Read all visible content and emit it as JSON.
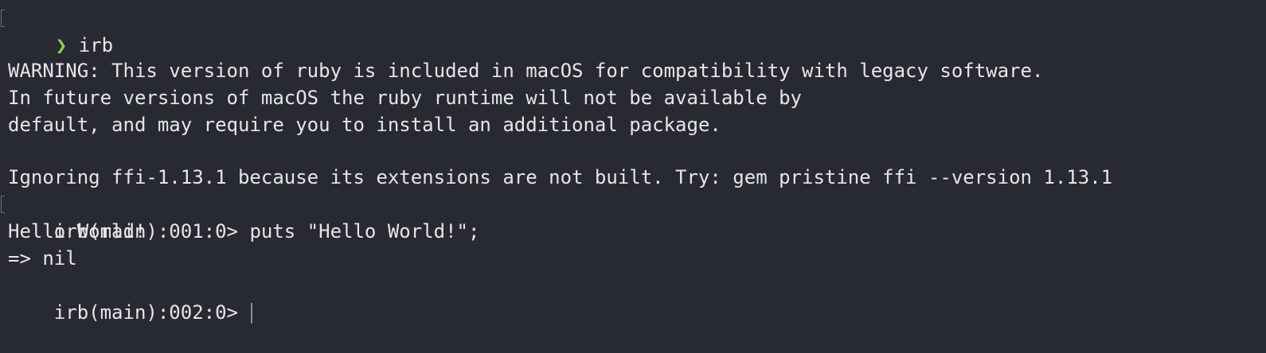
{
  "shell": {
    "prompt_symbol": "❯",
    "command": "irb"
  },
  "output": {
    "warning_line1": "WARNING: This version of ruby is included in macOS for compatibility with legacy software.",
    "warning_line2": "In future versions of macOS the ruby runtime will not be available by",
    "warning_line3": "default, and may require you to install an additional package.",
    "ignoring_line": "Ignoring ffi-1.13.1 because its extensions are not built. Try: gem pristine ffi --version 1.13.1",
    "irb_prompt_1": "irb(main):001:0> ",
    "irb_input_1": "puts \"Hello World!\";",
    "result_output": "Hello World!",
    "return_value": "=> nil",
    "irb_prompt_2": "irb(main):002:0> "
  },
  "colors": {
    "background": "#282a33",
    "text": "#e6e6e6",
    "prompt_arrow": "#8fd14f"
  }
}
